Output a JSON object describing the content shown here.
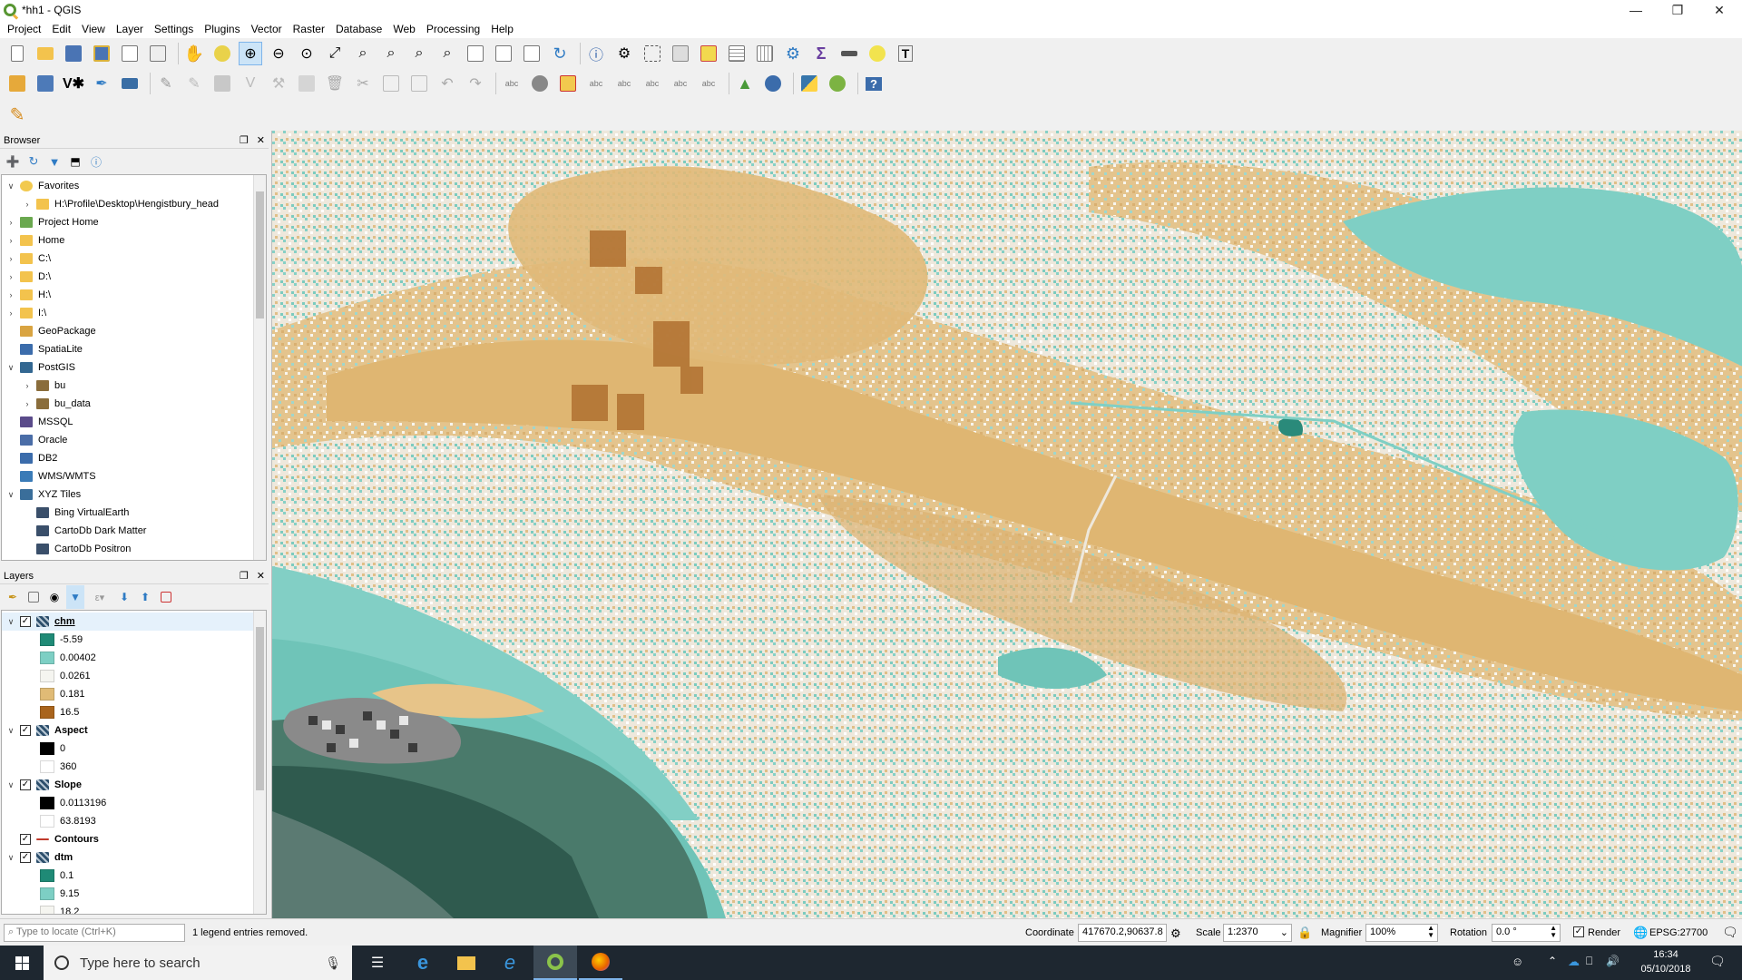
{
  "window": {
    "title": "*hh1 - QGIS"
  },
  "menu": [
    "Project",
    "Edit",
    "View",
    "Layer",
    "Settings",
    "Plugins",
    "Vector",
    "Raster",
    "Database",
    "Web",
    "Processing",
    "Help"
  ],
  "browser": {
    "title": "Browser",
    "items": [
      {
        "label": "Favorites",
        "icon": "star-icon",
        "level": 0,
        "expanded": true
      },
      {
        "label": "H:\\Profile\\Desktop\\Hengistbury_head",
        "icon": "folder-icon",
        "level": 1,
        "expanded": false
      },
      {
        "label": "Project Home",
        "icon": "project-home-icon",
        "level": 0,
        "expanded": false
      },
      {
        "label": "Home",
        "icon": "folder-icon",
        "level": 0,
        "expanded": false
      },
      {
        "label": "C:\\",
        "icon": "folder-icon",
        "level": 0,
        "expanded": false
      },
      {
        "label": "D:\\",
        "icon": "folder-icon",
        "level": 0,
        "expanded": false
      },
      {
        "label": "H:\\",
        "icon": "folder-icon",
        "level": 0,
        "expanded": false
      },
      {
        "label": "I:\\",
        "icon": "folder-icon",
        "level": 0,
        "expanded": false
      },
      {
        "label": "GeoPackage",
        "icon": "geopackage-icon",
        "level": 0,
        "expanded": null
      },
      {
        "label": "SpatiaLite",
        "icon": "spatialite-icon",
        "level": 0,
        "expanded": null
      },
      {
        "label": "PostGIS",
        "icon": "postgis-icon",
        "level": 0,
        "expanded": true
      },
      {
        "label": "bu",
        "icon": "connection-icon",
        "level": 1,
        "expanded": false
      },
      {
        "label": "bu_data",
        "icon": "connection-icon",
        "level": 1,
        "expanded": false
      },
      {
        "label": "MSSQL",
        "icon": "mssql-icon",
        "level": 0,
        "expanded": null
      },
      {
        "label": "Oracle",
        "icon": "oracle-icon",
        "level": 0,
        "expanded": null
      },
      {
        "label": "DB2",
        "icon": "db2-icon",
        "level": 0,
        "expanded": null
      },
      {
        "label": "WMS/WMTS",
        "icon": "wms-icon",
        "level": 0,
        "expanded": null
      },
      {
        "label": "XYZ Tiles",
        "icon": "xyz-icon",
        "level": 0,
        "expanded": true
      },
      {
        "label": "Bing VirtualEarth",
        "icon": "tile-icon",
        "level": 1,
        "expanded": null
      },
      {
        "label": "CartoDb Dark Matter",
        "icon": "tile-icon",
        "level": 1,
        "expanded": null
      },
      {
        "label": "CartoDb Positron",
        "icon": "tile-icon",
        "level": 1,
        "expanded": null
      }
    ]
  },
  "layers": {
    "title": "Layers",
    "items": [
      {
        "type": "layer",
        "label": "chm",
        "checked": true,
        "selected": true
      },
      {
        "type": "legend",
        "label": "-5.59",
        "color": "#1f8a76"
      },
      {
        "type": "legend",
        "label": "0.00402",
        "color": "#7dcfc4"
      },
      {
        "type": "legend",
        "label": "0.0261",
        "color": "#f5f5f0"
      },
      {
        "type": "legend",
        "label": "0.181",
        "color": "#e0bb76"
      },
      {
        "type": "legend",
        "label": "16.5",
        "color": "#a9641c"
      },
      {
        "type": "layer",
        "label": "Aspect",
        "checked": true
      },
      {
        "type": "legend",
        "label": "0",
        "color": "#000000"
      },
      {
        "type": "legend",
        "label": "360",
        "color": "#ffffff"
      },
      {
        "type": "layer",
        "label": "Slope",
        "checked": true
      },
      {
        "type": "legend",
        "label": "0.0113196",
        "color": "#000000"
      },
      {
        "type": "legend",
        "label": "63.8193",
        "color": "#ffffff"
      },
      {
        "type": "vector",
        "label": "Contours",
        "checked": true
      },
      {
        "type": "layer",
        "label": "dtm",
        "checked": true
      },
      {
        "type": "legend",
        "label": "0.1",
        "color": "#1f8a76"
      },
      {
        "type": "legend",
        "label": "9.15",
        "color": "#7dcfc4"
      },
      {
        "type": "legend",
        "label": "18.2",
        "color": "#f5f5f0"
      }
    ]
  },
  "status": {
    "locate_placeholder": "Type to locate (Ctrl+K)",
    "message": "1 legend entries removed.",
    "coordinate_label": "Coordinate",
    "coordinate": "417670.2,90637.8",
    "scale_label": "Scale",
    "scale": "1:2370",
    "magnifier_label": "Magnifier",
    "magnifier": "100%",
    "rotation_label": "Rotation",
    "rotation": "0.0 °",
    "render_label": "Render",
    "crs": "EPSG:27700"
  },
  "taskbar": {
    "search_placeholder": "Type here to search",
    "time": "16:34",
    "date": "05/10/2018"
  },
  "colors": {
    "accent_green": "#589632",
    "accent_yellow": "#eeb33c",
    "taskbar": "#1e2730"
  }
}
